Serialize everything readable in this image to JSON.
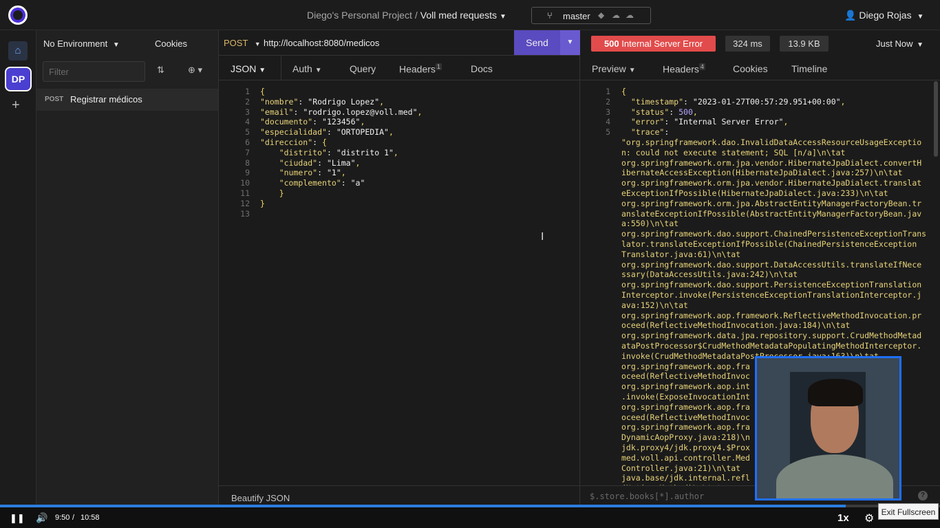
{
  "header": {
    "project": "Diego's Personal Project",
    "separator": "/",
    "collection": "Voll med requests",
    "branch": "master",
    "user": "Diego Rojas"
  },
  "rail": {
    "workspace_initials": "DP"
  },
  "sidebar": {
    "environment": "No Environment",
    "cookies": "Cookies",
    "filter_placeholder": "Filter",
    "requests": [
      {
        "method": "POST",
        "name": "Registrar médicos"
      }
    ]
  },
  "request": {
    "method": "POST",
    "url": "http://localhost:8080/medicos",
    "send_label": "Send",
    "tabs": [
      {
        "label": "JSON"
      },
      {
        "label": "Auth"
      },
      {
        "label": "Query"
      },
      {
        "label": "Headers",
        "badge": "1"
      },
      {
        "label": "Docs"
      }
    ],
    "body_lines": [
      "{",
      "\"nombre\": \"Rodrigo Lopez\",",
      "\"email\": \"rodrigo.lopez@voll.med\",",
      "\"documento\": \"123456\",",
      "\"especialidad\": \"ORTOPEDIA\",",
      "\"direccion\": {",
      "    \"distrito\": \"distrito 1\",",
      "    \"ciudad\": \"Lima\",",
      "    \"numero\": \"1\",",
      "    \"complemento\": \"a\"",
      "    }",
      "}",
      ""
    ],
    "beautify_label": "Beautify JSON"
  },
  "response": {
    "status_code": "500",
    "status_text": "Internal Server Error",
    "time": "324 ms",
    "size": "13.9 KB",
    "when": "Just Now",
    "tabs": [
      {
        "label": "Preview"
      },
      {
        "label": "Headers",
        "badge": "4"
      },
      {
        "label": "Cookies"
      },
      {
        "label": "Timeline"
      }
    ],
    "body_lines": [
      "{",
      "  \"timestamp\": \"2023-01-27T00:57:29.951+00:00\",",
      "  \"status\": 500,",
      "  \"error\": \"Internal Server Error\",",
      "  \"trace\":",
      "\"org.springframework.dao.InvalidDataAccessResourceUsageExceptio",
      "n: could not execute statement; SQL [n/a]\\n\\tat",
      "org.springframework.orm.jpa.vendor.HibernateJpaDialect.convertH",
      "ibernateAccessException(HibernateJpaDialect.java:257)\\n\\tat",
      "org.springframework.orm.jpa.vendor.HibernateJpaDialect.translat",
      "eExceptionIfPossible(HibernateJpaDialect.java:233)\\n\\tat",
      "org.springframework.orm.jpa.AbstractEntityManagerFactoryBean.tr",
      "anslateExceptionIfPossible(AbstractEntityManagerFactoryBean.jav",
      "a:550)\\n\\tat",
      "org.springframework.dao.support.ChainedPersistenceExceptionTrans",
      "lator.translateExceptionIfPossible(ChainedPersistenceException",
      "Translator.java:61)\\n\\tat",
      "org.springframework.dao.support.DataAccessUtils.translateIfNece",
      "ssary(DataAccessUtils.java:242)\\n\\tat",
      "org.springframework.dao.support.PersistenceExceptionTranslation",
      "Interceptor.invoke(PersistenceExceptionTranslationInterceptor.j",
      "ava:152)\\n\\tat",
      "org.springframework.aop.framework.ReflectiveMethodInvocation.pr",
      "oceed(ReflectiveMethodInvocation.java:184)\\n\\tat",
      "org.springframework.data.jpa.repository.support.CrudMethodMetad",
      "ataPostProcessor$CrudMethodMetadataPopulatingMethodInterceptor.",
      "invoke(CrudMethodMetadataPostProcessor.java:163)\\n\\tat",
      "org.springframework.aop.fra",
      "oceed(ReflectiveMethodInvoc",
      "org.springframework.aop.int",
      ".invoke(ExposeInvocationInt",
      "org.springframework.aop.fra",
      "oceed(ReflectiveMethodInvoc",
      "org.springframework.aop.fra",
      "DynamicAopProxy.java:218)\\n",
      "jdk.proxy4/jdk.proxy4.$Prox",
      "med.voll.api.controller.Med",
      "Controller.java:21)\\n\\tat",
      "java.base/jdk.internal.refl",
      "(Native Method)\\n\\tat"
    ],
    "jsonpath_placeholder": "$.store.books[*].author"
  },
  "player": {
    "progress": 0.9,
    "current_time": "9:50",
    "time_separator": "/",
    "total_time": "10:58",
    "speed": "1x",
    "exit_fullscreen": "Exit Fullscreen"
  },
  "colors": {
    "accent": "#5a4bc0",
    "error": "#e24b4b",
    "progress": "#2b7de0"
  },
  "icons": {
    "logo": "insomnia-logo",
    "home": "home-icon",
    "branch": "git-branch-icon",
    "user": "user-icon",
    "settings": "gear-icon"
  }
}
